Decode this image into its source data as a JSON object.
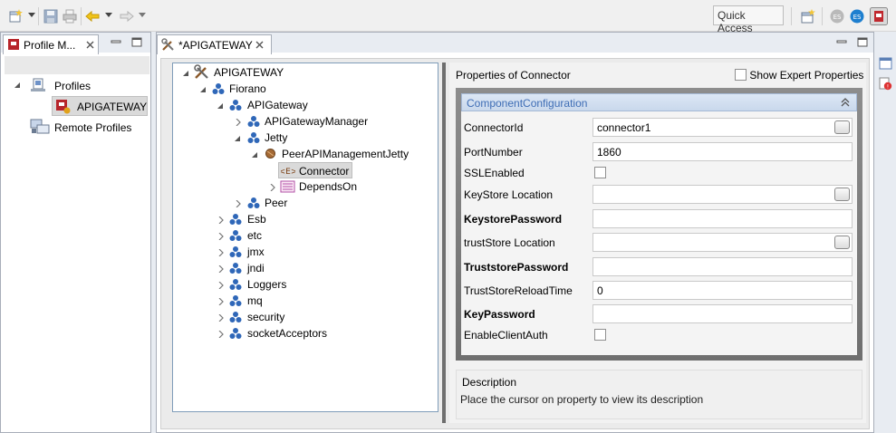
{
  "toolbar": {
    "quick_access_label": "Quick Access",
    "icons": [
      "new-wizard-icon",
      "save-icon",
      "save-all-icon",
      "print-icon",
      "back-icon",
      "forward-icon",
      "open-perspective-icon",
      "perspective-es-gray-icon",
      "perspective-es-blue-icon",
      "perspective-profile-icon"
    ]
  },
  "left_view": {
    "tab_label": "Profile M...",
    "tree": {
      "root_label": "Profiles",
      "selected_label": "APIGATEWAY",
      "remote_label": "Remote Profiles"
    }
  },
  "editor": {
    "tab_label": "*APIGATEWAY",
    "tree": {
      "root": "APIGATEWAY",
      "nodes": [
        "Fiorano",
        "APIGateway",
        "APIGatewayManager",
        "Jetty",
        "PeerAPIManagementJetty",
        "Connector",
        "DependsOn",
        "Peer",
        "Esb",
        "etc",
        "jmx",
        "jndi",
        "Loggers",
        "mq",
        "security",
        "socketAcceptors"
      ],
      "selected": "Connector"
    },
    "properties": {
      "title": "Properties of Connector",
      "expert_label": "Show Expert Properties",
      "expert_checked": false,
      "section_title": "ComponentConfiguration",
      "rows": [
        {
          "label": "ConnectorId",
          "value": "connector1",
          "bold": false,
          "kind": "text-button"
        },
        {
          "label": "PortNumber",
          "value": "1860",
          "bold": false,
          "kind": "text"
        },
        {
          "label": "SSLEnabled",
          "value": "",
          "bold": false,
          "kind": "checkbox"
        },
        {
          "label": "KeyStore Location",
          "value": "",
          "bold": false,
          "kind": "text-button"
        },
        {
          "label": "KeystorePassword",
          "value": "",
          "bold": true,
          "kind": "text"
        },
        {
          "label": "trustStore Location",
          "value": "",
          "bold": false,
          "kind": "text-button"
        },
        {
          "label": "TruststorePassword",
          "value": "",
          "bold": true,
          "kind": "text"
        },
        {
          "label": "TrustStoreReloadTime",
          "value": "0",
          "bold": false,
          "kind": "text"
        },
        {
          "label": "KeyPassword",
          "value": "",
          "bold": true,
          "kind": "text"
        },
        {
          "label": "EnableClientAuth",
          "value": "",
          "bold": false,
          "kind": "checkbox"
        }
      ],
      "description_title": "Description",
      "description_text": "Place the cursor on property to view its description"
    }
  },
  "colors": {
    "accent_header": "#3e6db5",
    "selection": "#dadada",
    "node_icon_blue": "#2f67b8"
  }
}
